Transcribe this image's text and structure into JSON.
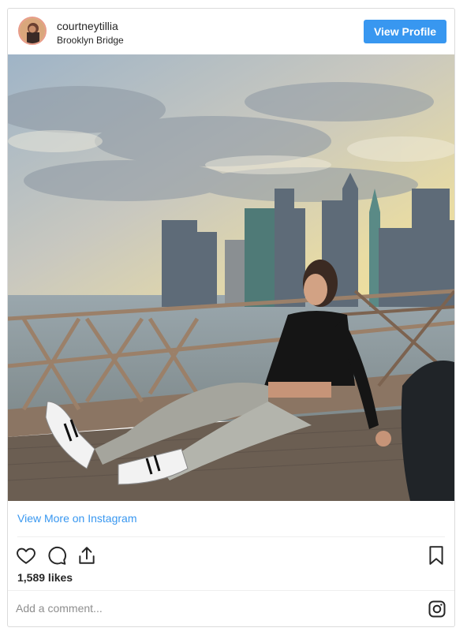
{
  "post": {
    "username": "courtneytillia",
    "location": "Brooklyn Bridge",
    "view_profile_label": "View Profile",
    "image_alt": "photo",
    "view_more_label": "View More on Instagram",
    "likes": "1,589 likes",
    "comment_placeholder": "Add a comment..."
  },
  "icons": {
    "avatar": "profile-avatar",
    "like": "heart-icon",
    "comment": "comment-bubble-icon",
    "share": "share-icon",
    "save": "bookmark-icon",
    "instagram": "instagram-logo-icon"
  },
  "colors": {
    "accent": "#3897f0",
    "text": "#262626",
    "muted": "#8e8e8e",
    "border": "#dbdbdb"
  }
}
